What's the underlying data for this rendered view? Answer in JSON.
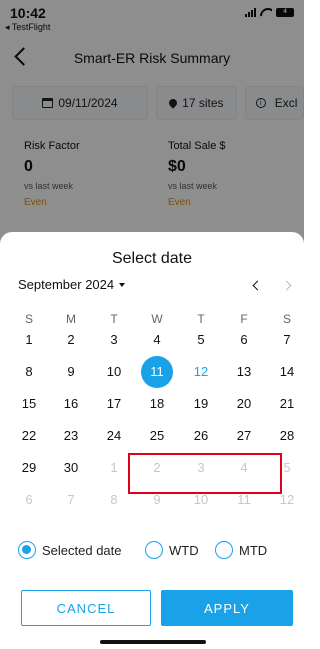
{
  "status_bar": {
    "time": "10:42",
    "back_app": "◂ TestFlight",
    "battery": "4"
  },
  "navbar": {
    "title": "Smart-ER Risk Summary"
  },
  "filters": {
    "date": "09/11/2024",
    "sites": "17 sites",
    "exclude": "Excl"
  },
  "stats": [
    {
      "label": "Risk Factor",
      "value": "0",
      "sub": "vs last week",
      "trend": "Even"
    },
    {
      "label": "Total Sale $",
      "value": "$0",
      "sub": "vs last week",
      "trend": "Even"
    }
  ],
  "sheet": {
    "title": "Select date",
    "month": "September 2024",
    "weekdays": [
      "S",
      "M",
      "T",
      "W",
      "T",
      "F",
      "S"
    ],
    "weeks": [
      [
        "1",
        "2",
        "3",
        "4",
        "5",
        "6",
        "7"
      ],
      [
        "8",
        "9",
        "10",
        "11",
        "12",
        "13",
        "14"
      ],
      [
        "15",
        "16",
        "17",
        "18",
        "19",
        "20",
        "21"
      ],
      [
        "22",
        "23",
        "24",
        "25",
        "26",
        "27",
        "28"
      ],
      [
        "29",
        "30",
        "1",
        "2",
        "3",
        "4",
        "5"
      ],
      [
        "6",
        "7",
        "8",
        "9",
        "10",
        "11",
        "12"
      ]
    ],
    "selected_day": "11",
    "today_day": "12",
    "options": [
      {
        "label": "Selected date",
        "checked": true
      },
      {
        "label": "WTD",
        "checked": false
      },
      {
        "label": "MTD",
        "checked": false
      }
    ],
    "cancel_label": "CANCEL",
    "apply_label": "APPLY"
  },
  "colors": {
    "accent": "#1aa2e8",
    "highlight": "#e0001a",
    "trend": "#e08a00"
  }
}
